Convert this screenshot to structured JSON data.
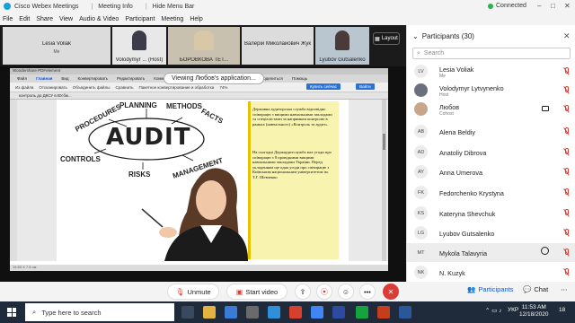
{
  "titlebar": {
    "app_title": "Cisco Webex Meetings",
    "meeting_info": "Meeting Info",
    "hide_menu_bar": "Hide Menu Bar",
    "connected": "Connected",
    "minimize": "–",
    "maximize": "□",
    "close": "✕"
  },
  "menu": [
    "File",
    "Edit",
    "Share",
    "View",
    "Audio & Video",
    "Participant",
    "Meeting",
    "Help"
  ],
  "video_strip": {
    "tiles": [
      {
        "name": "Lesia Voliak",
        "sub": "Me"
      },
      {
        "name": "Volodymyr ... (Host)",
        "sub": ""
      },
      {
        "name": "БОРОВКОВА ТЕТ...",
        "sub": ""
      },
      {
        "name": "Валерій Миколайович Жук",
        "sub": ""
      },
      {
        "name": "Lyubov Gutsalenko",
        "sub": ""
      }
    ],
    "layout_label": "Layout"
  },
  "share": {
    "viewing_label": "Viewing Любов's application...",
    "pdf_title": "Wondershare PDFelement",
    "pdf_menu": [
      "Файл",
      "Главная",
      "Вид",
      "Конвертировать",
      "Редактировать",
      "Комментарий",
      "Страница",
      "Форма",
      "Защита",
      "Поделиться",
      "Помощь"
    ],
    "pdf_tools": [
      "Из файла",
      "Отсканировать",
      "Объединить файлы",
      "Сравнить",
      "Пакетное конвертирование и обработка",
      "74%"
    ],
    "pdf_button_1": "Купить сейчас",
    "pdf_button_2": "Войти",
    "pdf_tab": "контроль до ДКСУ в ВУ.бж...",
    "audit_words": {
      "procedures": "PROCEDURES",
      "planning": "PLANNING",
      "methods": "METHODS",
      "facts": "FACTS",
      "audit": "AUDIT",
      "controls": "CONTROLS",
      "risks": "RISKS",
      "management": "MANAGEMENT"
    },
    "yellow_text_1": "Державна аудиторська служба відповідно співпрацю з вищими навчальними закладами та спеціалістами за напрямком контролю в рамках (навчального) «Контроль та аудит».",
    "yellow_text_2": "На сьогодні Держаудитслужба має угоди про співпрацю з 8 провідними вищими навчальними закладами України. Перед укладенням ще одна угоди про співпрацю з Київським національним університетом ім. Т.Г. Шевченко",
    "pdf_status": "19.83 X 7.5 см"
  },
  "controls": {
    "unmute": "Unmute",
    "start_video": "Start video",
    "more": "•••"
  },
  "panel": {
    "header": "Participants (30)",
    "search_placeholder": "Search",
    "participants": [
      {
        "initials": "LV",
        "name": "Lesia Voliak",
        "role": "Me"
      },
      {
        "initials": "",
        "name": "Volodymyr Lytvynenko",
        "role": "Host"
      },
      {
        "initials": "",
        "name": "Любов",
        "role": "Cohost"
      },
      {
        "initials": "AB",
        "name": "Alena Beldiy",
        "role": ""
      },
      {
        "initials": "AD",
        "name": "Anatoliy Dibrova",
        "role": ""
      },
      {
        "initials": "AY",
        "name": "Anna Umerova",
        "role": ""
      },
      {
        "initials": "FK",
        "name": "Fedorchenko Krystyna",
        "role": ""
      },
      {
        "initials": "KS",
        "name": "Kateryna Shevchuk",
        "role": ""
      },
      {
        "initials": "LG",
        "name": "Lyubov Gutsalenko",
        "role": ""
      },
      {
        "initials": "MT",
        "name": "Mykola Talavyria",
        "role": ""
      },
      {
        "initials": "NK",
        "name": "N. Kuzyk",
        "role": ""
      }
    ],
    "footer_participants": "Participants",
    "footer_chat": "Chat"
  },
  "taskbar": {
    "search_placeholder": "Type here to search",
    "lang": "УКР",
    "time": "11:53 AM",
    "date": "12/18/2020",
    "notif_count": "18"
  }
}
